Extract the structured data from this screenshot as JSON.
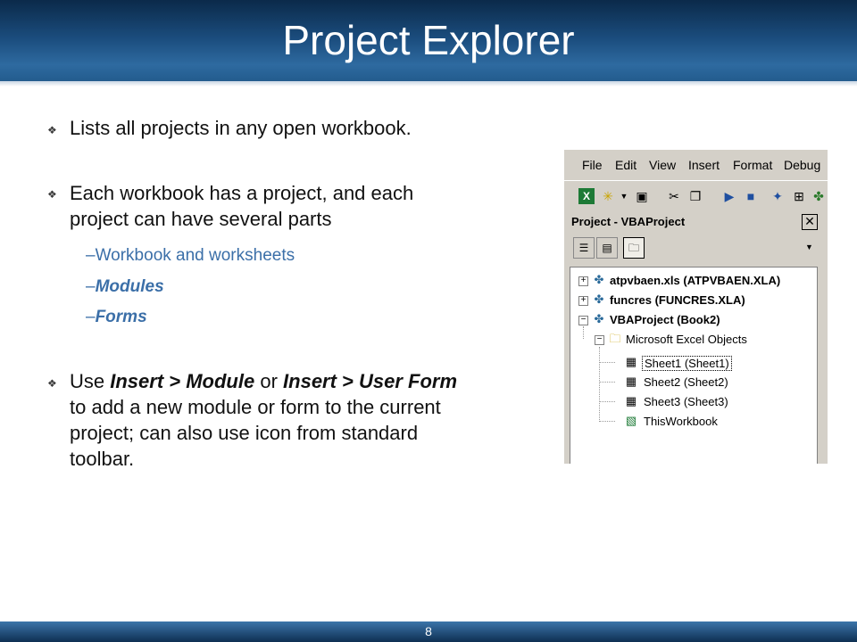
{
  "slide": {
    "title": "Project Explorer",
    "page_number": "8"
  },
  "bullets": [
    {
      "text": "Lists all projects in any open workbook."
    },
    {
      "line1": "Each workbook has a project, and each",
      "line2": "project can have several parts"
    },
    {
      "parts": [
        "Use ",
        "Insert > Module",
        " or ",
        "Insert > User Form"
      ],
      "line2": "to add a new module or form to the current",
      "line3": "project; can also use icon from standard",
      "line4": "toolbar."
    }
  ],
  "sub_items": [
    {
      "dash": "–",
      "text": "Workbook and worksheets"
    },
    {
      "dash": "–",
      "text": "Modules"
    },
    {
      "dash": "–",
      "text": "Forms"
    }
  ],
  "colors": {
    "accent": "#1b4d7e",
    "sub_item": "#3b6fa8"
  },
  "vba": {
    "menu": [
      "File",
      "Edit",
      "View",
      "Insert",
      "Format",
      "Debug"
    ],
    "toolbar_icons": [
      "excel-icon",
      "insert-userform-icon",
      "dropdown-arrow-icon",
      "save-icon",
      "cut-icon",
      "copy-icon",
      "run-icon",
      "reset-icon",
      "design-mode-icon",
      "project-explorer-icon",
      "properties-icon"
    ],
    "pane_title": "Project - VBAProject",
    "close_label": "✕",
    "view_buttons": [
      "view-code-icon",
      "view-object-icon",
      "toggle-folders-icon"
    ],
    "tree": [
      {
        "label": "atpvbaen.xls (ATPVBAEN.XLA)",
        "expander": "+"
      },
      {
        "label": "funcres (FUNCRES.XLA)",
        "expander": "+"
      },
      {
        "label": "VBAProject (Book2)",
        "expander": "−"
      },
      {
        "label": "Microsoft Excel Objects",
        "expander": "−"
      },
      {
        "label": "Sheet1 (Sheet1)"
      },
      {
        "label": "Sheet2 (Sheet2)"
      },
      {
        "label": "Sheet3 (Sheet3)"
      },
      {
        "label": "ThisWorkbook"
      }
    ]
  }
}
